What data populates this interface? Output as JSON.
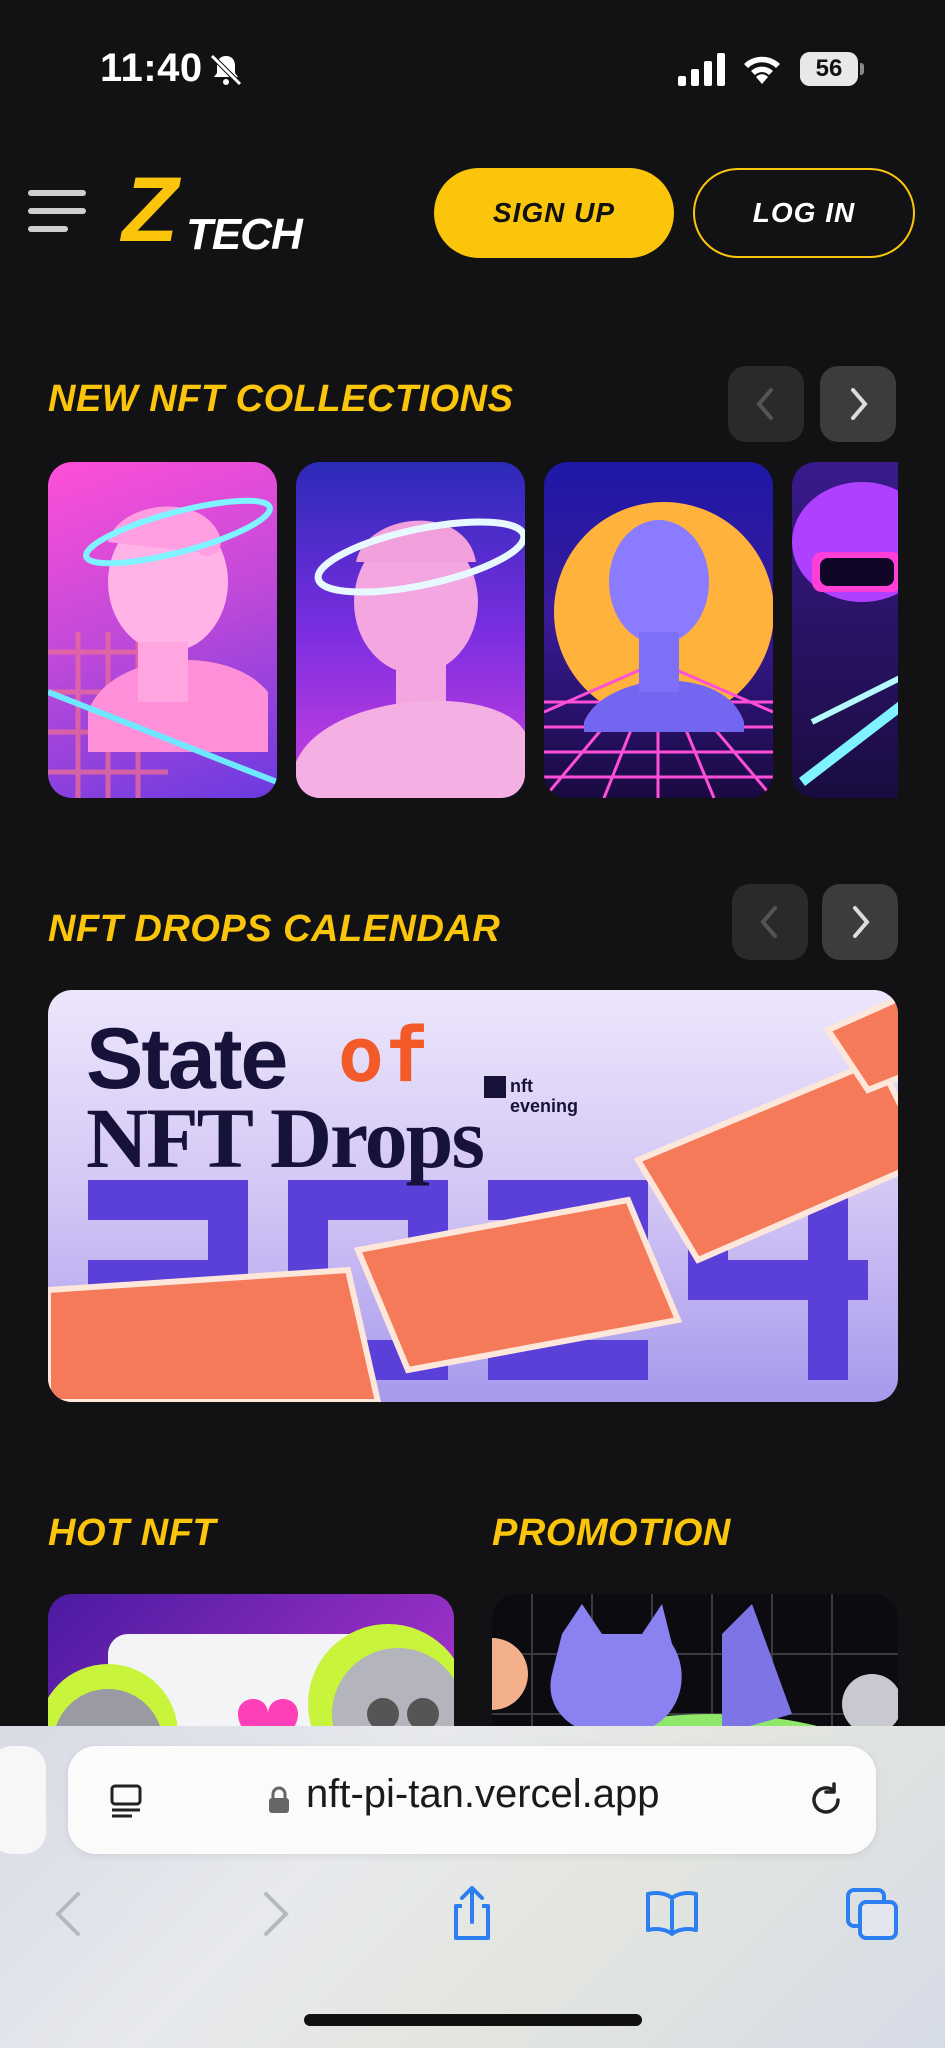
{
  "status_bar": {
    "time": "11:40",
    "battery_level": "56",
    "icons": [
      "bell-slash-icon",
      "signal-icon",
      "wifi-icon",
      "battery-icon"
    ]
  },
  "header": {
    "logo_text": "TECH",
    "logo_mark": "Z",
    "signup_label": "SIGN UP",
    "login_label": "LOG IN",
    "accent_color": "#fbc50c"
  },
  "sections": {
    "new_collections": {
      "title": "NEW NFT COLLECTIONS",
      "cards": [
        "pink-statue",
        "blue-statue",
        "sunset-statue",
        "cyber-avatar"
      ]
    },
    "drops_calendar": {
      "title": "NFT DROPS CALENDAR",
      "banner": {
        "line1": "State",
        "of": "of",
        "line2": "NFT Drops",
        "brand_top": "nft",
        "brand_bottom": "evening"
      }
    },
    "hot_nft": {
      "title": "HOT NFT"
    },
    "promotion": {
      "title": "PROMOTION"
    }
  },
  "browser": {
    "url": "nft-pi-tan.vercel.app",
    "icons": [
      "reader-icon",
      "lock-icon",
      "reload-icon",
      "back-icon",
      "forward-icon",
      "share-icon",
      "bookmarks-icon",
      "tabs-icon"
    ]
  }
}
